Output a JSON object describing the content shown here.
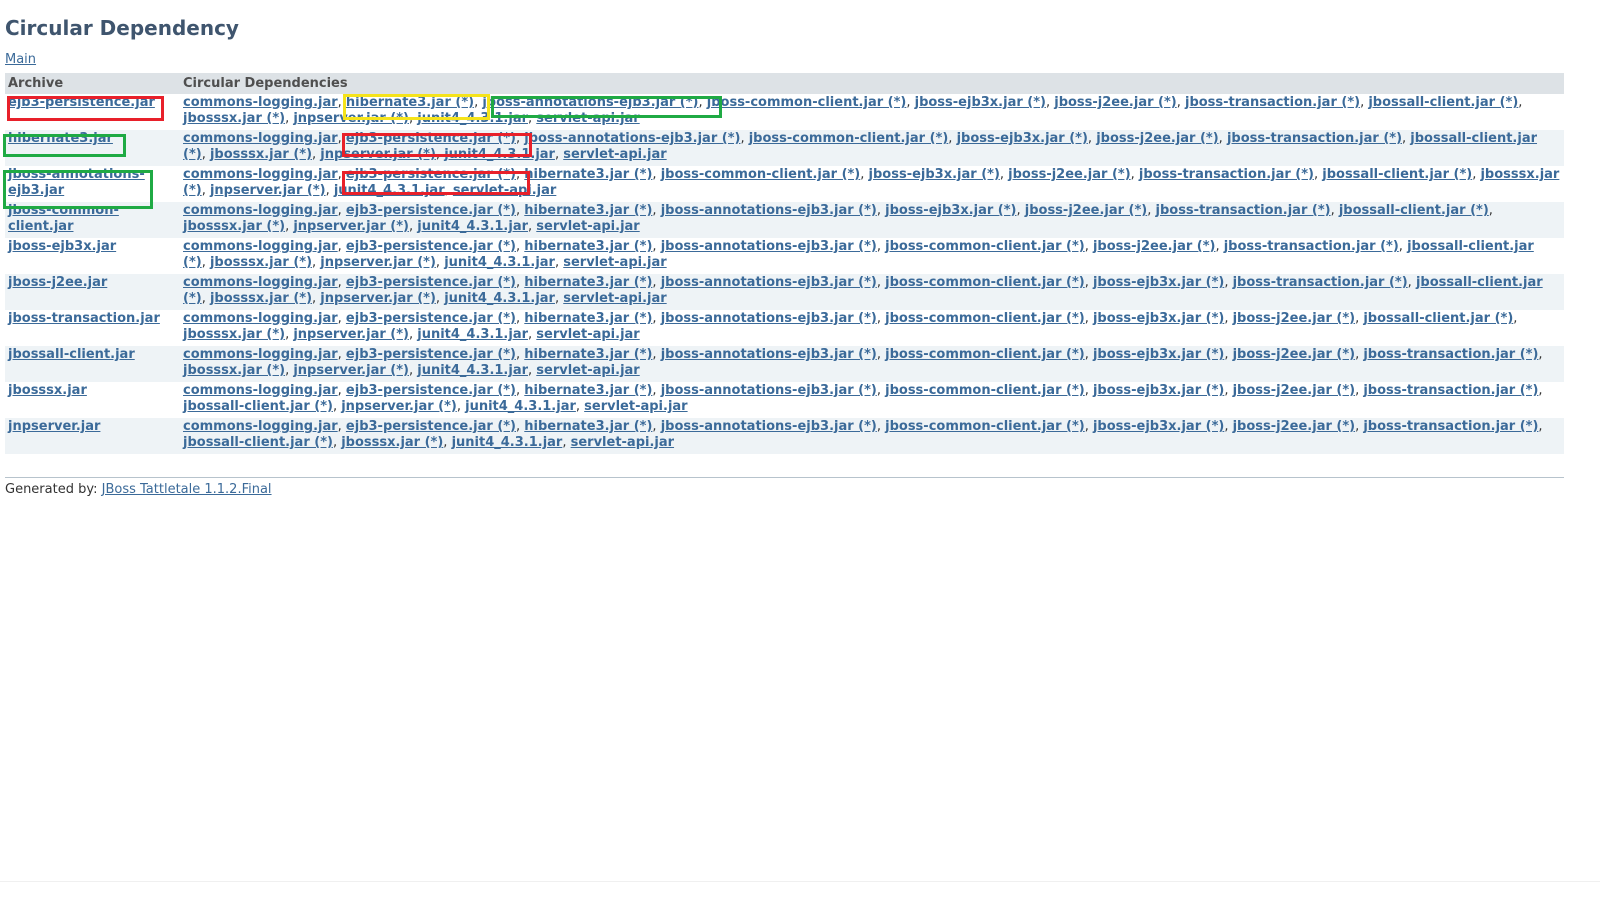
{
  "page": {
    "title": "Circular Dependency",
    "main_link": "Main"
  },
  "table": {
    "headers": [
      "Archive",
      "Circular Dependencies"
    ],
    "rows": [
      {
        "archive": "ejb3-persistence.jar",
        "deps": [
          "commons-logging.jar",
          "hibernate3.jar (*)",
          "jboss-annotations-ejb3.jar (*)",
          "jboss-common-client.jar (*)",
          "jboss-ejb3x.jar (*)",
          "jboss-j2ee.jar (*)",
          "jboss-transaction.jar (*)",
          "jbossall-client.jar (*)",
          "jbosssx.jar (*)",
          "jnpserver.jar (*)",
          "junit4_4.3.1.jar",
          "servlet-api.jar"
        ]
      },
      {
        "archive": "hibernate3.jar",
        "deps": [
          "commons-logging.jar",
          "ejb3-persistence.jar (*)",
          "jboss-annotations-ejb3.jar (*)",
          "jboss-common-client.jar (*)",
          "jboss-ejb3x.jar (*)",
          "jboss-j2ee.jar (*)",
          "jboss-transaction.jar (*)",
          "jbossall-client.jar (*)",
          "jbosssx.jar (*)",
          "jnpserver.jar (*)",
          "junit4_4.3.1.jar",
          "servlet-api.jar"
        ]
      },
      {
        "archive": "jboss-annotations-ejb3.jar",
        "deps": [
          "commons-logging.jar",
          "ejb3-persistence.jar (*)",
          "hibernate3.jar (*)",
          "jboss-common-client.jar (*)",
          "jboss-ejb3x.jar (*)",
          "jboss-j2ee.jar (*)",
          "jboss-transaction.jar (*)",
          "jbossall-client.jar (*)",
          "jbosssx.jar (*)",
          "jnpserver.jar (*)",
          "junit4_4.3.1.jar",
          "servlet-api.jar"
        ]
      },
      {
        "archive": "jboss-common-client.jar",
        "deps": [
          "commons-logging.jar",
          "ejb3-persistence.jar (*)",
          "hibernate3.jar (*)",
          "jboss-annotations-ejb3.jar (*)",
          "jboss-ejb3x.jar (*)",
          "jboss-j2ee.jar (*)",
          "jboss-transaction.jar (*)",
          "jbossall-client.jar (*)",
          "jbosssx.jar (*)",
          "jnpserver.jar (*)",
          "junit4_4.3.1.jar",
          "servlet-api.jar"
        ]
      },
      {
        "archive": "jboss-ejb3x.jar",
        "deps": [
          "commons-logging.jar",
          "ejb3-persistence.jar (*)",
          "hibernate3.jar (*)",
          "jboss-annotations-ejb3.jar (*)",
          "jboss-common-client.jar (*)",
          "jboss-j2ee.jar (*)",
          "jboss-transaction.jar (*)",
          "jbossall-client.jar (*)",
          "jbosssx.jar (*)",
          "jnpserver.jar (*)",
          "junit4_4.3.1.jar",
          "servlet-api.jar"
        ]
      },
      {
        "archive": "jboss-j2ee.jar",
        "deps": [
          "commons-logging.jar",
          "ejb3-persistence.jar (*)",
          "hibernate3.jar (*)",
          "jboss-annotations-ejb3.jar (*)",
          "jboss-common-client.jar (*)",
          "jboss-ejb3x.jar (*)",
          "jboss-transaction.jar (*)",
          "jbossall-client.jar (*)",
          "jbosssx.jar (*)",
          "jnpserver.jar (*)",
          "junit4_4.3.1.jar",
          "servlet-api.jar"
        ]
      },
      {
        "archive": "jboss-transaction.jar",
        "deps": [
          "commons-logging.jar",
          "ejb3-persistence.jar (*)",
          "hibernate3.jar (*)",
          "jboss-annotations-ejb3.jar (*)",
          "jboss-common-client.jar (*)",
          "jboss-ejb3x.jar (*)",
          "jboss-j2ee.jar (*)",
          "jbossall-client.jar (*)",
          "jbosssx.jar (*)",
          "jnpserver.jar (*)",
          "junit4_4.3.1.jar",
          "servlet-api.jar"
        ]
      },
      {
        "archive": "jbossall-client.jar",
        "deps": [
          "commons-logging.jar",
          "ejb3-persistence.jar (*)",
          "hibernate3.jar (*)",
          "jboss-annotations-ejb3.jar (*)",
          "jboss-common-client.jar (*)",
          "jboss-ejb3x.jar (*)",
          "jboss-j2ee.jar (*)",
          "jboss-transaction.jar (*)",
          "jbosssx.jar (*)",
          "jnpserver.jar (*)",
          "junit4_4.3.1.jar",
          "servlet-api.jar"
        ]
      },
      {
        "archive": "jbosssx.jar",
        "deps": [
          "commons-logging.jar",
          "ejb3-persistence.jar (*)",
          "hibernate3.jar (*)",
          "jboss-annotations-ejb3.jar (*)",
          "jboss-common-client.jar (*)",
          "jboss-ejb3x.jar (*)",
          "jboss-j2ee.jar (*)",
          "jboss-transaction.jar (*)",
          "jbossall-client.jar (*)",
          "jnpserver.jar (*)",
          "junit4_4.3.1.jar",
          "servlet-api.jar"
        ]
      },
      {
        "archive": "jnpserver.jar",
        "deps": [
          "commons-logging.jar",
          "ejb3-persistence.jar (*)",
          "hibernate3.jar (*)",
          "jboss-annotations-ejb3.jar (*)",
          "jboss-common-client.jar (*)",
          "jboss-ejb3x.jar (*)",
          "jboss-j2ee.jar (*)",
          "jboss-transaction.jar (*)",
          "jbossall-client.jar (*)",
          "jbosssx.jar (*)",
          "junit4_4.3.1.jar",
          "servlet-api.jar"
        ]
      }
    ]
  },
  "footer": {
    "prefix": "Generated by: ",
    "link": "JBoss Tattletale 1.1.2.Final"
  },
  "colors": {
    "link": "#3b6a99",
    "title": "#3f556e",
    "header_bg": "#dde2e6",
    "row_alt_bg": "#eef3f6",
    "highlight_red": "#e8202a",
    "highlight_yellow": "#f5e31b",
    "highlight_green": "#1faa44"
  }
}
